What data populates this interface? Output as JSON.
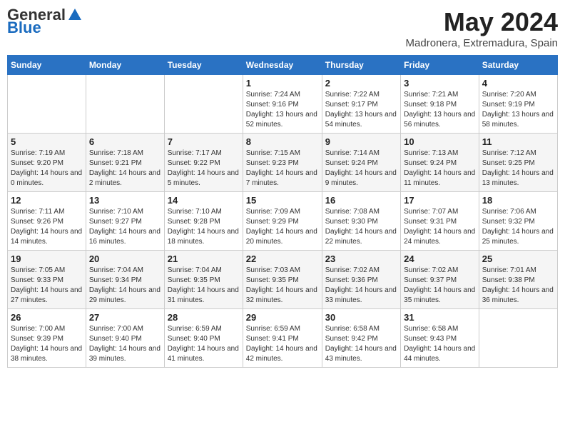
{
  "header": {
    "logo_general": "General",
    "logo_blue": "Blue",
    "month_title": "May 2024",
    "location": "Madronera, Extremadura, Spain"
  },
  "days_of_week": [
    "Sunday",
    "Monday",
    "Tuesday",
    "Wednesday",
    "Thursday",
    "Friday",
    "Saturday"
  ],
  "weeks": [
    [
      null,
      null,
      null,
      {
        "day": "1",
        "sunrise": "Sunrise: 7:24 AM",
        "sunset": "Sunset: 9:16 PM",
        "daylight": "Daylight: 13 hours and 52 minutes."
      },
      {
        "day": "2",
        "sunrise": "Sunrise: 7:22 AM",
        "sunset": "Sunset: 9:17 PM",
        "daylight": "Daylight: 13 hours and 54 minutes."
      },
      {
        "day": "3",
        "sunrise": "Sunrise: 7:21 AM",
        "sunset": "Sunset: 9:18 PM",
        "daylight": "Daylight: 13 hours and 56 minutes."
      },
      {
        "day": "4",
        "sunrise": "Sunrise: 7:20 AM",
        "sunset": "Sunset: 9:19 PM",
        "daylight": "Daylight: 13 hours and 58 minutes."
      }
    ],
    [
      {
        "day": "5",
        "sunrise": "Sunrise: 7:19 AM",
        "sunset": "Sunset: 9:20 PM",
        "daylight": "Daylight: 14 hours and 0 minutes."
      },
      {
        "day": "6",
        "sunrise": "Sunrise: 7:18 AM",
        "sunset": "Sunset: 9:21 PM",
        "daylight": "Daylight: 14 hours and 2 minutes."
      },
      {
        "day": "7",
        "sunrise": "Sunrise: 7:17 AM",
        "sunset": "Sunset: 9:22 PM",
        "daylight": "Daylight: 14 hours and 5 minutes."
      },
      {
        "day": "8",
        "sunrise": "Sunrise: 7:15 AM",
        "sunset": "Sunset: 9:23 PM",
        "daylight": "Daylight: 14 hours and 7 minutes."
      },
      {
        "day": "9",
        "sunrise": "Sunrise: 7:14 AM",
        "sunset": "Sunset: 9:24 PM",
        "daylight": "Daylight: 14 hours and 9 minutes."
      },
      {
        "day": "10",
        "sunrise": "Sunrise: 7:13 AM",
        "sunset": "Sunset: 9:24 PM",
        "daylight": "Daylight: 14 hours and 11 minutes."
      },
      {
        "day": "11",
        "sunrise": "Sunrise: 7:12 AM",
        "sunset": "Sunset: 9:25 PM",
        "daylight": "Daylight: 14 hours and 13 minutes."
      }
    ],
    [
      {
        "day": "12",
        "sunrise": "Sunrise: 7:11 AM",
        "sunset": "Sunset: 9:26 PM",
        "daylight": "Daylight: 14 hours and 14 minutes."
      },
      {
        "day": "13",
        "sunrise": "Sunrise: 7:10 AM",
        "sunset": "Sunset: 9:27 PM",
        "daylight": "Daylight: 14 hours and 16 minutes."
      },
      {
        "day": "14",
        "sunrise": "Sunrise: 7:10 AM",
        "sunset": "Sunset: 9:28 PM",
        "daylight": "Daylight: 14 hours and 18 minutes."
      },
      {
        "day": "15",
        "sunrise": "Sunrise: 7:09 AM",
        "sunset": "Sunset: 9:29 PM",
        "daylight": "Daylight: 14 hours and 20 minutes."
      },
      {
        "day": "16",
        "sunrise": "Sunrise: 7:08 AM",
        "sunset": "Sunset: 9:30 PM",
        "daylight": "Daylight: 14 hours and 22 minutes."
      },
      {
        "day": "17",
        "sunrise": "Sunrise: 7:07 AM",
        "sunset": "Sunset: 9:31 PM",
        "daylight": "Daylight: 14 hours and 24 minutes."
      },
      {
        "day": "18",
        "sunrise": "Sunrise: 7:06 AM",
        "sunset": "Sunset: 9:32 PM",
        "daylight": "Daylight: 14 hours and 25 minutes."
      }
    ],
    [
      {
        "day": "19",
        "sunrise": "Sunrise: 7:05 AM",
        "sunset": "Sunset: 9:33 PM",
        "daylight": "Daylight: 14 hours and 27 minutes."
      },
      {
        "day": "20",
        "sunrise": "Sunrise: 7:04 AM",
        "sunset": "Sunset: 9:34 PM",
        "daylight": "Daylight: 14 hours and 29 minutes."
      },
      {
        "day": "21",
        "sunrise": "Sunrise: 7:04 AM",
        "sunset": "Sunset: 9:35 PM",
        "daylight": "Daylight: 14 hours and 31 minutes."
      },
      {
        "day": "22",
        "sunrise": "Sunrise: 7:03 AM",
        "sunset": "Sunset: 9:35 PM",
        "daylight": "Daylight: 14 hours and 32 minutes."
      },
      {
        "day": "23",
        "sunrise": "Sunrise: 7:02 AM",
        "sunset": "Sunset: 9:36 PM",
        "daylight": "Daylight: 14 hours and 33 minutes."
      },
      {
        "day": "24",
        "sunrise": "Sunrise: 7:02 AM",
        "sunset": "Sunset: 9:37 PM",
        "daylight": "Daylight: 14 hours and 35 minutes."
      },
      {
        "day": "25",
        "sunrise": "Sunrise: 7:01 AM",
        "sunset": "Sunset: 9:38 PM",
        "daylight": "Daylight: 14 hours and 36 minutes."
      }
    ],
    [
      {
        "day": "26",
        "sunrise": "Sunrise: 7:00 AM",
        "sunset": "Sunset: 9:39 PM",
        "daylight": "Daylight: 14 hours and 38 minutes."
      },
      {
        "day": "27",
        "sunrise": "Sunrise: 7:00 AM",
        "sunset": "Sunset: 9:40 PM",
        "daylight": "Daylight: 14 hours and 39 minutes."
      },
      {
        "day": "28",
        "sunrise": "Sunrise: 6:59 AM",
        "sunset": "Sunset: 9:40 PM",
        "daylight": "Daylight: 14 hours and 41 minutes."
      },
      {
        "day": "29",
        "sunrise": "Sunrise: 6:59 AM",
        "sunset": "Sunset: 9:41 PM",
        "daylight": "Daylight: 14 hours and 42 minutes."
      },
      {
        "day": "30",
        "sunrise": "Sunrise: 6:58 AM",
        "sunset": "Sunset: 9:42 PM",
        "daylight": "Daylight: 14 hours and 43 minutes."
      },
      {
        "day": "31",
        "sunrise": "Sunrise: 6:58 AM",
        "sunset": "Sunset: 9:43 PM",
        "daylight": "Daylight: 14 hours and 44 minutes."
      },
      null
    ]
  ]
}
